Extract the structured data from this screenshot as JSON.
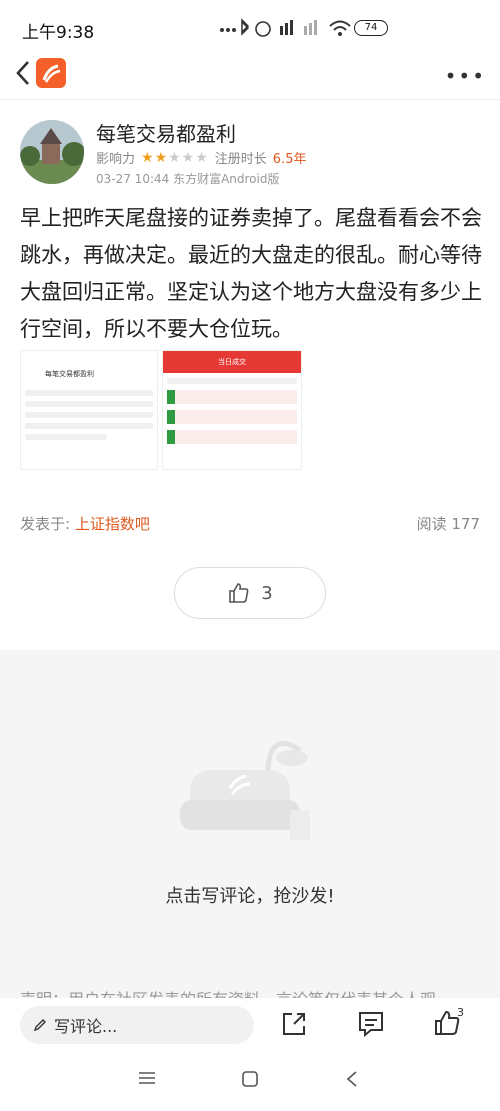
{
  "status_bar": {
    "time": "上午9:38",
    "icons": "... ✱ ⏰ HD ▮▮▮ ▮▮▮ ≋",
    "battery": "74"
  },
  "author": {
    "name": "每笔交易都盈利",
    "influence_label": "影响力",
    "stars_filled": 2,
    "stars_total": 5,
    "register_label": "注册时长",
    "register_years": "6.5年",
    "post_time": "03-27 10:44 东方财富Android版"
  },
  "post": {
    "body": "早上把昨天尾盘接的证券卖掉了。尾盘看看会不会跳水，再做决定。最近的大盘走的很乱。耐心等待大盘回归正常。坚定认为这个地方大盘没有多少上行空间，所以不要大仓位玩。"
  },
  "images": {
    "shot1_title": "每笔交易都盈利",
    "shot2_title": "当日成交"
  },
  "footer": {
    "posted_in_label": "发表于:",
    "posted_in_link": "上证指数吧",
    "read_count": "阅读 177"
  },
  "like": {
    "count": "3"
  },
  "comments": {
    "empty_text": "点击写评论，抢沙发!",
    "disclaimer": "声明：用户在社区发表的所有资料、言论等仅代表其个人观"
  },
  "bottom_bar": {
    "comment_placeholder": "写评论...",
    "like_count": "3"
  }
}
